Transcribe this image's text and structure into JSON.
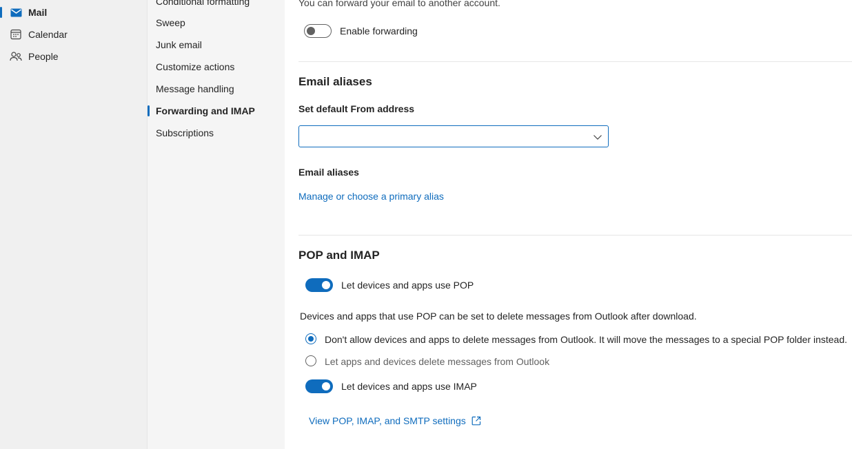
{
  "nav": {
    "items": [
      {
        "label": "Mail",
        "icon": "mail-icon",
        "active": true
      },
      {
        "label": "Calendar",
        "icon": "calendar-icon",
        "active": false
      },
      {
        "label": "People",
        "icon": "people-icon",
        "active": false
      }
    ]
  },
  "subnav": {
    "items": [
      {
        "label": "Conditional formatting"
      },
      {
        "label": "Sweep"
      },
      {
        "label": "Junk email"
      },
      {
        "label": "Customize actions"
      },
      {
        "label": "Message handling"
      },
      {
        "label": "Forwarding and IMAP",
        "active": true
      },
      {
        "label": "Subscriptions"
      }
    ]
  },
  "forwarding": {
    "description": "You can forward your email to another account.",
    "toggle_label": "Enable forwarding",
    "enabled": false
  },
  "aliases": {
    "title": "Email aliases",
    "default_from_label": "Set default From address",
    "default_from_value": "",
    "list_label": "Email aliases",
    "manage_link": "Manage or choose a primary alias"
  },
  "pop_imap": {
    "title": "POP and IMAP",
    "pop_toggle_label": "Let devices and apps use POP",
    "pop_enabled": true,
    "delete_description": "Devices and apps that use POP can be set to delete messages from Outlook after download.",
    "radio_options": [
      {
        "label": "Don't allow devices and apps to delete messages from Outlook. It will move the messages to a special POP folder instead.",
        "checked": true
      },
      {
        "label": "Let apps and devices delete messages from Outlook",
        "checked": false
      }
    ],
    "imap_toggle_label": "Let devices and apps use IMAP",
    "imap_enabled": true,
    "settings_link": "View POP, IMAP, and SMTP settings",
    "settings_link_icon": "open-external-icon"
  },
  "colors": {
    "accent": "#0f6cbd",
    "nav_bg": "#f0f0f0",
    "subnav_bg": "#f5f5f5"
  }
}
